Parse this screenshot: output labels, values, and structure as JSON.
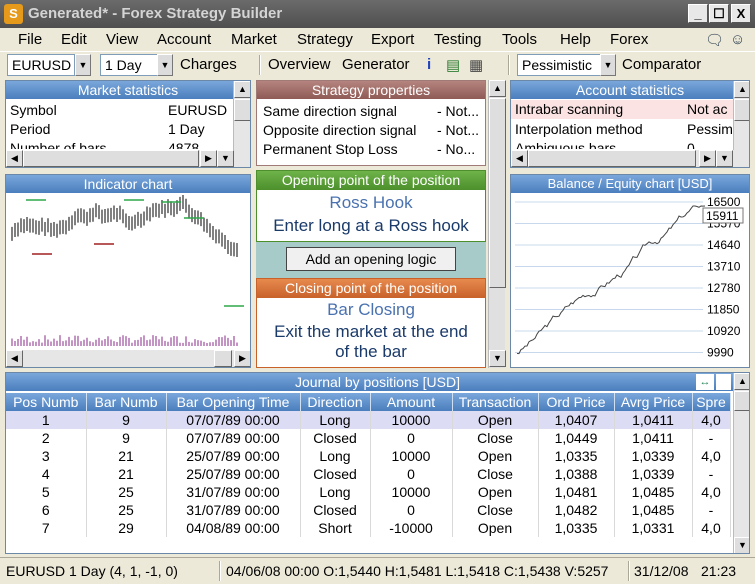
{
  "window": {
    "title": "Generated* - Forex Strategy Builder",
    "app_icon": "S",
    "buttons": [
      "_",
      "☐",
      "X"
    ]
  },
  "menu": [
    "File",
    "Edit",
    "View",
    "Account",
    "Market",
    "Strategy",
    "Export",
    "Testing",
    "Tools",
    "Help",
    "Forex"
  ],
  "toolbar": {
    "symbol": "EURUSD",
    "period": "1 Day",
    "charges": "Charges",
    "overview": "Overview",
    "generator": "Generator",
    "info_icon": "info-icon",
    "calc_icon": "calculator-icon",
    "pessimistic": "Pessimistic",
    "comparator": "Comparator"
  },
  "market_stats": {
    "title": "Market statistics",
    "rows": [
      {
        "k": "Symbol",
        "v": "EURUSD"
      },
      {
        "k": "Period",
        "v": "1 Day"
      },
      {
        "k": "Number of bars",
        "v": "4878"
      }
    ]
  },
  "indicator_chart": {
    "title": "Indicator chart"
  },
  "strategy_props": {
    "title": "Strategy properties",
    "rows": [
      {
        "k": "Same direction signal",
        "v": "- Not..."
      },
      {
        "k": "Opposite direction signal",
        "v": "- Not..."
      },
      {
        "k": "Permanent Stop Loss",
        "v": "- No..."
      }
    ]
  },
  "opening": {
    "header": "Opening point of the position",
    "name": "Ross Hook",
    "desc": "Enter long at a Ross hook"
  },
  "add_logic_button": "Add an opening logic",
  "closing": {
    "header": "Closing point of the position",
    "name": "Bar Closing",
    "desc": "Exit the market at the end of the bar"
  },
  "account_stats": {
    "title": "Account statistics",
    "rows": [
      {
        "k": "Intrabar scanning",
        "v": "Not ac"
      },
      {
        "k": "Interpolation method",
        "v": "Pessim"
      },
      {
        "k": "Ambiguous bars",
        "v": "0"
      }
    ]
  },
  "balance_chart": {
    "title": "Balance / Equity chart [USD]",
    "ticks": [
      "16500",
      "15570",
      "14640",
      "13710",
      "12780",
      "11850",
      "10920",
      "9990"
    ],
    "current_value": "15911"
  },
  "journal": {
    "title": "Journal by positions [USD]",
    "columns": [
      "Pos Numb",
      "Bar Numb",
      "Bar Opening Time",
      "Direction",
      "Amount",
      "Transaction",
      "Ord Price",
      "Avrg Price",
      "Spre"
    ],
    "rows": [
      [
        "1",
        "9",
        "07/07/89 00:00",
        "Long",
        "10000",
        "Open",
        "1,0407",
        "1,0411",
        "4,0"
      ],
      [
        "2",
        "9",
        "07/07/89 00:00",
        "Closed",
        "0",
        "Close",
        "1,0449",
        "1,0411",
        "-"
      ],
      [
        "3",
        "21",
        "25/07/89 00:00",
        "Long",
        "10000",
        "Open",
        "1,0335",
        "1,0339",
        "4,0"
      ],
      [
        "4",
        "21",
        "25/07/89 00:00",
        "Closed",
        "0",
        "Close",
        "1,0388",
        "1,0339",
        "-"
      ],
      [
        "5",
        "25",
        "31/07/89 00:00",
        "Long",
        "10000",
        "Open",
        "1,0481",
        "1,0485",
        "4,0"
      ],
      [
        "6",
        "25",
        "31/07/89 00:00",
        "Closed",
        "0",
        "Close",
        "1,0482",
        "1,0485",
        "-"
      ],
      [
        "7",
        "29",
        "04/08/89 00:00",
        "Short",
        "-10000",
        "Open",
        "1,0335",
        "1,0331",
        "4,0"
      ]
    ]
  },
  "status": {
    "left": "EURUSD 1 Day (4, 1, -1, 0)",
    "middle": "04/06/08 00:00 O:1,5440 H:1,5481 L:1,5418 C:1,5438 V:5257",
    "date": "31/12/08",
    "time": "21:23"
  }
}
